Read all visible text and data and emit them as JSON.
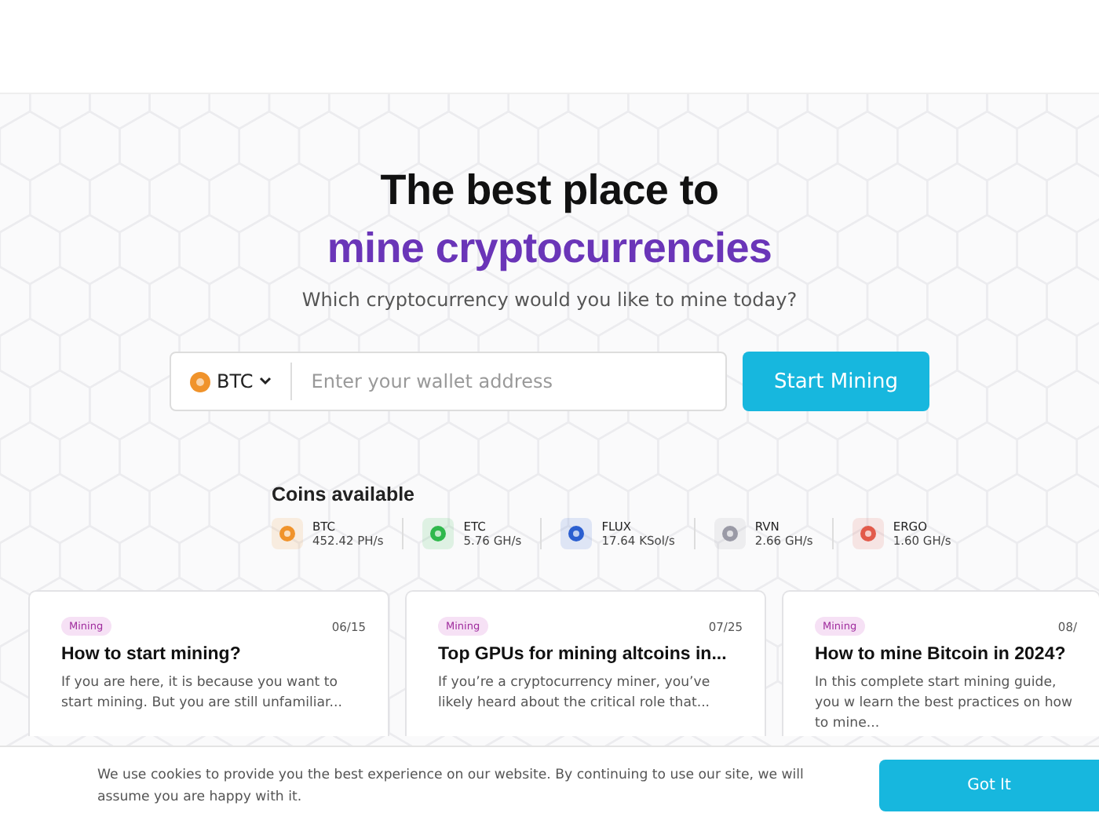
{
  "hero": {
    "title_line_1": "The best place to",
    "title_line_2": "mine cryptocurrencies",
    "subtitle": "Which cryptocurrency would you like to mine today?"
  },
  "mining_form": {
    "coin": "BTC",
    "placeholder": "Enter your wallet address",
    "button": "Start Mining"
  },
  "coins_available": {
    "title": "Coins available",
    "coins": [
      {
        "symbol": "BTC",
        "rate": "452.42 PH/s",
        "color": "#f0932b"
      },
      {
        "symbol": "ETC",
        "rate": "5.76 GH/s",
        "color": "#2fb84c"
      },
      {
        "symbol": "FLUX",
        "rate": "17.64 KSol/s",
        "color": "#2b5fd0"
      },
      {
        "symbol": "RVN",
        "rate": "2.66 GH/s",
        "color": "#9a9aa6"
      },
      {
        "symbol": "ERGO",
        "rate": "1.60 GH/s",
        "color": "#e25a4a"
      }
    ]
  },
  "articles": [
    {
      "tag": "Mining",
      "date": "06/15",
      "title": "How to start mining?",
      "excerpt": "If you are here, it is because you want to start mining. But you are still unfamiliar..."
    },
    {
      "tag": "Mining",
      "date": "07/25",
      "title": "Top GPUs for mining altcoins in...",
      "excerpt": "If you’re a cryptocurrency miner, you’ve likely heard about the critical role that..."
    },
    {
      "tag": "Mining",
      "date": "08/",
      "title": "How to mine Bitcoin in 2024?",
      "excerpt": "In this complete start mining guide, you w learn the best practices on how to mine..."
    }
  ],
  "cookie_banner": {
    "text": "We use cookies to provide you the best experience on our website. By continuing to use our site, we will assume you are happy with it.",
    "button": "Got It"
  }
}
